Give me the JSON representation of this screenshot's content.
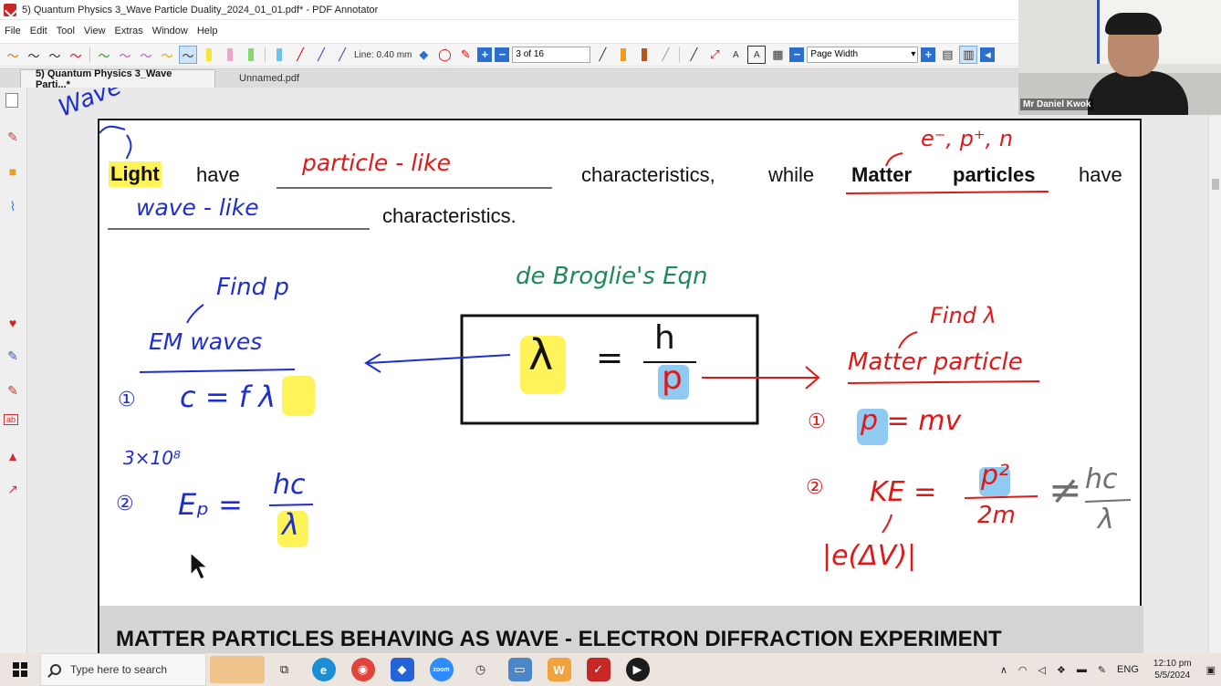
{
  "window": {
    "title": "5) Quantum Physics 3_Wave Particle Duality_2024_01_01.pdf* - PDF Annotator"
  },
  "menu": [
    "File",
    "Edit",
    "Tool",
    "View",
    "Extras",
    "Window",
    "Help"
  ],
  "toolbar": {
    "line_label": "Line: 0.40 mm",
    "page_indicator": "3 of 16",
    "zoom_value": "Page Width"
  },
  "tabs": [
    {
      "label": "5) Quantum Physics 3_Wave Parti...*"
    },
    {
      "label": "Unnamed.pdf"
    }
  ],
  "document": {
    "sentence": {
      "light": "Light",
      "have1": "have",
      "characteristics1": "characteristics,",
      "while": "while",
      "matter": "Matter",
      "particles": "particles",
      "have2": "have",
      "characteristics2": "characteristics."
    },
    "section_heading": "MATTER PARTICLES BEHAVING AS WAVE - ELECTRON DIFFRACTION EXPERIMENT",
    "handwriting": {
      "wave_top": "Wave",
      "particle_like": "particle - like",
      "wave_like": "wave - like",
      "particles_list": "e⁻, p⁺, n",
      "de_broglie": "de Broglie's Eqn",
      "find_p": "Find p",
      "em_waves": "EM waves",
      "eq1_num": "①",
      "eq1": "c = f λ",
      "speed": "3×10⁸",
      "eq2_num": "②",
      "eq2_lhs": "Eₚ =",
      "eq2_top": "hc",
      "eq2_bottom": "λ",
      "find_lambda": "Find λ",
      "matter_particle": "Matter particle",
      "mp1_num": "①",
      "mp1": "p = mv",
      "mp2_num": "②",
      "mp2_lhs": "KE =",
      "mp2_top": "p²",
      "mp2_bottom": "2m",
      "neq": "≠",
      "neq_top": "hc",
      "neq_bottom": "λ",
      "evolt": "|e(ΔV)|"
    },
    "equation_box": {
      "lambda": "λ",
      "equals": "=",
      "numerator": "h",
      "denominator": "p"
    }
  },
  "webcam": {
    "name": "Mr Daniel Kwok"
  },
  "taskbar": {
    "search_placeholder": "Type here to search",
    "language": "ENG",
    "time": "12:10 pm",
    "date": "5/5/2024"
  },
  "colors": {
    "ink_blue": "#1f2fcf",
    "ink_red": "#e01818",
    "ink_green": "#1e8a58",
    "highlight_yellow": "#fff35a",
    "highlight_blue": "#8fcaf2"
  }
}
